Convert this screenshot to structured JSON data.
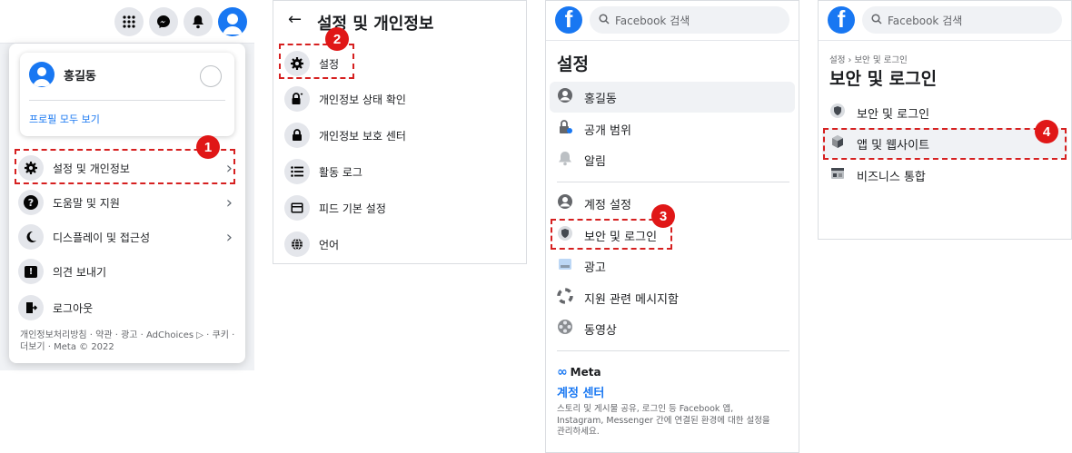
{
  "panel1": {
    "profile_name": "홍길동",
    "see_all_profiles": "프로필 모두 보기",
    "menu": [
      {
        "label": "설정 및 개인정보"
      },
      {
        "label": "도움말 및 지원"
      },
      {
        "label": "디스플레이 및 접근성"
      },
      {
        "label": "의견 보내기"
      },
      {
        "label": "로그아웃"
      }
    ],
    "footer_line1": "개인정보처리방침 · 약관 · 광고 · AdChoices ▷ · 쿠키 ·",
    "footer_line2": "더보기 · Meta © 2022",
    "badge": "1"
  },
  "panel2": {
    "title": "설정 및 개인정보",
    "items": [
      {
        "label": "설정"
      },
      {
        "label": "개인정보 상태 확인"
      },
      {
        "label": "개인정보 보호 센터"
      },
      {
        "label": "활동 로그"
      },
      {
        "label": "피드 기본 설정"
      },
      {
        "label": "언어"
      }
    ],
    "badge": "2"
  },
  "panel3": {
    "search_placeholder": "Facebook 검색",
    "title": "설정",
    "items_top": [
      {
        "label": "홍길동"
      },
      {
        "label": "공개 범위"
      },
      {
        "label": "알림"
      }
    ],
    "items_bottom": [
      {
        "label": "계정 설정"
      },
      {
        "label": "보안 및 로그인"
      },
      {
        "label": "광고"
      },
      {
        "label": "지원 관련 메시지함"
      },
      {
        "label": "동영상"
      }
    ],
    "meta_brand": "Meta",
    "account_center": "계정 센터",
    "account_desc1": "스토리 및 게시물 공유, 로그인 등 Facebook 앱,",
    "account_desc2": "Instagram, Messenger 간에 연결된 환경에 대한 설정을",
    "account_desc3": "관리하세요.",
    "badge": "3"
  },
  "panel4": {
    "search_placeholder": "Facebook 검색",
    "breadcrumb": "설정 › 보안 및 로그인",
    "title": "보안 및 로그인",
    "items": [
      {
        "label": "보안 및 로그인"
      },
      {
        "label": "앱 및 웹사이트"
      },
      {
        "label": "비즈니스 통합"
      }
    ],
    "badge": "4"
  },
  "colors": {
    "accent": "#1877f2",
    "badge": "#e01717",
    "hover": "#f0f2f5"
  }
}
